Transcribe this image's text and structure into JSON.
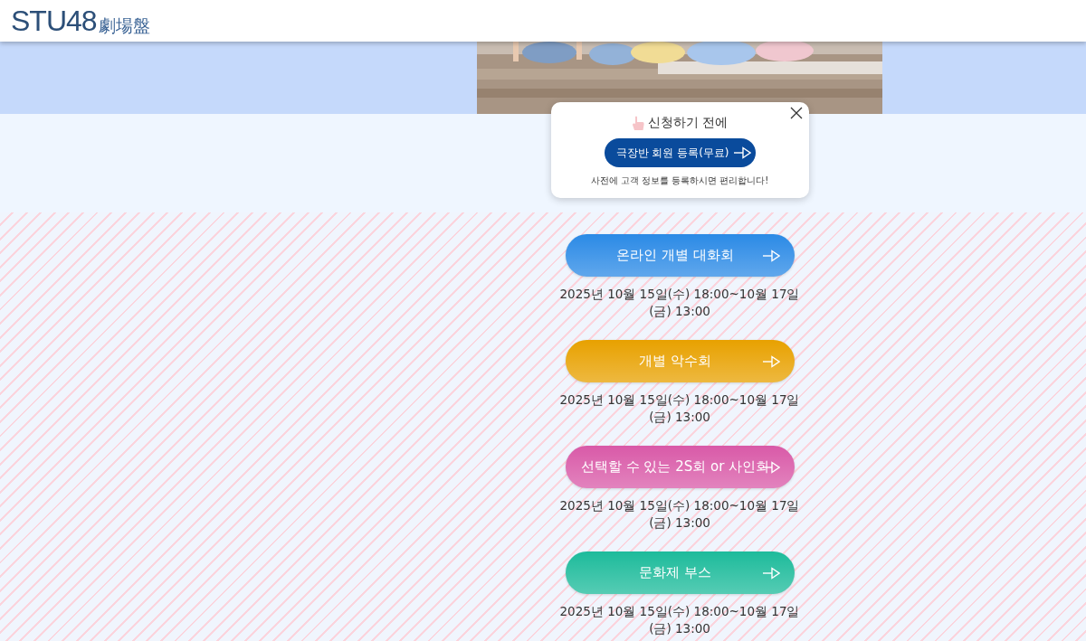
{
  "header": {
    "logo": {
      "name": "STU48",
      "subtitle": "劇場盤"
    }
  },
  "popup": {
    "title": "신청하기 전에",
    "button": "극장반 회원 등록(무료)",
    "note": "사전에 고객 정보를 등록하시면 편리합니다!"
  },
  "events": [
    {
      "label": "온라인 개별 대화회",
      "color": "#2b8ae6",
      "period": "2025년 10월 15일(수) 18:00~10월 17일(금) 13:00"
    },
    {
      "label": "개별 악수회",
      "color": "#e8a100",
      "period": "2025년 10월 15일(수) 18:00~10월 17일(금) 13:00"
    },
    {
      "label": "선택할 수 있는 2S회 or 사인회",
      "color": "#d95aa8",
      "period": "2025년 10월 15일(수) 18:00~10월 17일(금) 13:00"
    },
    {
      "label": "문화제 부스",
      "color": "#1dbb9b",
      "period": "2025년 10월 15일(수) 18:00~10월 17일(금) 13:00"
    }
  ]
}
